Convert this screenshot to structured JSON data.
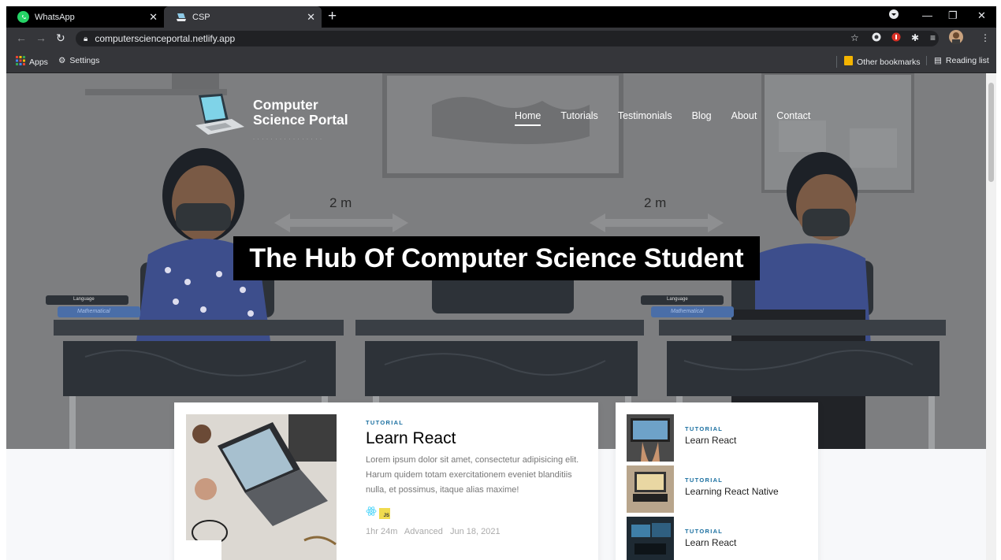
{
  "browser": {
    "tabs": [
      {
        "label": "WhatsApp",
        "active": false,
        "favicon": "whatsapp-icon"
      },
      {
        "label": "CSP",
        "active": true,
        "favicon": "laptop-icon"
      }
    ],
    "url": "computerscienceportal.netlify.app",
    "bookmarks": {
      "apps": "Apps",
      "settings": "Settings",
      "other": "Other bookmarks",
      "reading": "Reading list"
    }
  },
  "site": {
    "brand_line1": "Computer",
    "brand_line2": "Science Portal",
    "nav": [
      "Home",
      "Tutorials",
      "Testimonials",
      "Blog",
      "About",
      "Contact"
    ],
    "hero": {
      "distance_left": "2 m",
      "distance_right": "2 m",
      "headline": {
        "p1": "The ",
        "p2": "Hub",
        "p3": " Of ",
        "p4": "Computer Science Student"
      }
    },
    "featured": {
      "kicker": "TUTORIAL",
      "title": "Learn React",
      "excerpt": "Lorem ipsum dolor sit amet, consectetur adipisicing elit. Harum quidem totam exercitationem eveniet blanditiis nulla, et possimus, itaque alias maxime!",
      "meta": "1hr 24m   Advanced   Jun 18, 2021",
      "badge_js": "JS"
    },
    "side": [
      {
        "kicker": "TUTORIAL",
        "title": "Learn React"
      },
      {
        "kicker": "TUTORIAL",
        "title": "Learning React Native"
      },
      {
        "kicker": "TUTORIAL",
        "title": "Learn React"
      }
    ],
    "desk_labels": {
      "language": "Language",
      "math": "Mathematical"
    }
  },
  "colors": {
    "accent": "#1a6fa0",
    "hero_bg": "#7d7e80",
    "headline_bg": "#000000"
  }
}
